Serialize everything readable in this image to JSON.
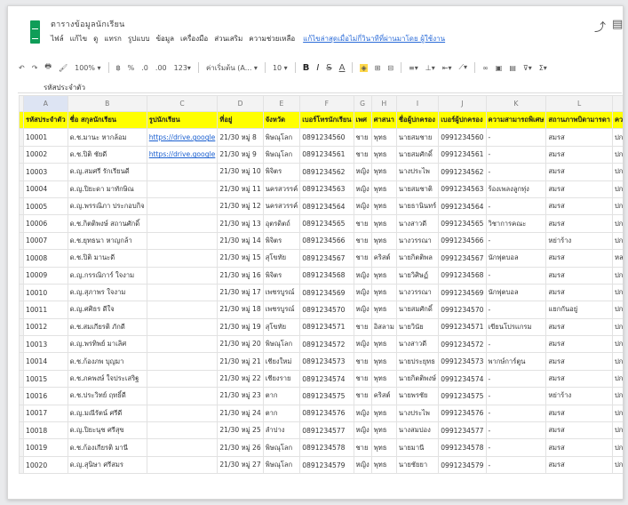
{
  "window": {
    "doc_title": "ตารางข้อมูลนักเรียน",
    "menu": [
      "ไฟล์",
      "แก้ไข",
      "ดู",
      "แทรก",
      "รูปแบบ",
      "ข้อมูล",
      "เครื่องมือ",
      "ส่วนเสริม",
      "ความช่วยเหลือ"
    ],
    "last_edit": "แก้ไขล่าสุดเมื่อไม่กี่วินาทีที่ผ่านมาโดย ผู้ใช้งาน"
  },
  "toolbar": {
    "undo": "↶",
    "redo": "↷",
    "print": "🖶",
    "paint": "🖌",
    "zoom": "100% ▾",
    "currency": "฿",
    "percent": "%",
    "dec_less": ".0",
    "dec_more": ".00",
    "format": "123▾",
    "font": "ค่าเริ่มต้น (A... ▾",
    "font_size": "10 ▾",
    "bold": "B",
    "italic": "I",
    "strike": "S",
    "text_color": "A",
    "fill": "◈",
    "borders": "⊞",
    "merge": "⊟",
    "align": "≡▾",
    "valign": "⊥▾",
    "wrap": "⇤▾",
    "rotate": "⟋▾",
    "link": "∞",
    "comment": "▣",
    "chart": "▤",
    "filter": "⊽▾",
    "functions": "Σ▾"
  },
  "formula_bar": "รหัสประจำตัว",
  "columns": [
    "A",
    "B",
    "C",
    "D",
    "E",
    "F",
    "G",
    "H",
    "I",
    "J",
    "K",
    "L",
    "M"
  ],
  "header_row": [
    "รหัสประจำตัว",
    "ชื่อ สกุลนักเรียน",
    "รูปนักเรียน",
    "ที่อยู่",
    "จังหวัด",
    "เบอร์โทรนักเรียน",
    "เพศ",
    "ศาสนา",
    "ชื่อผู้ปกครอง",
    "เบอร์ผู้ปกครอง",
    "ความสามารถพิเศษ",
    "สถานภาพบิดามารดา",
    "ความประพฤติ"
  ],
  "rows": [
    [
      "10001",
      "ด.ช.มานะ หากล้อม",
      "https://drive.google",
      "21/30 หมู่ 8",
      "พิษณุโลก",
      "0891234560",
      "ชาย",
      "พุทธ",
      "นายสมชาย",
      "0991234560",
      "-",
      "สมรส",
      "ปกติ"
    ],
    [
      "10002",
      "ด.ช.ปิติ ชัยดี",
      "https://drive.google",
      "21/30 หมู่ 9",
      "พิษณุโลก",
      "0891234561",
      "ชาย",
      "พุทธ",
      "นายสมศักดิ์",
      "0991234561",
      "-",
      "สมรส",
      "ปกติ"
    ],
    [
      "10003",
      "ด.ญ.สมศรี รักเรียนดี",
      "",
      "21/30 หมู่ 10",
      "พิจิตร",
      "0891234562",
      "หญิง",
      "พุทธ",
      "นางประไพ",
      "0991234562",
      "-",
      "สมรส",
      "ปกติ"
    ],
    [
      "10004",
      "ด.ญ.ปิยะดา มาทักษิณ",
      "",
      "21/30 หมู่ 11",
      "นครสวรรค์",
      "0891234563",
      "หญิง",
      "พุทธ",
      "นายสมชาติ",
      "0991234563",
      "ร้องเพลงลูกทุ่ง",
      "สมรส",
      "ปกติ"
    ],
    [
      "10005",
      "ด.ญ.พรรณิภา ประกอบกิจ",
      "",
      "21/30 หมู่ 12",
      "นครสวรรค์",
      "0891234564",
      "หญิง",
      "พุทธ",
      "นายธานินทร์",
      "0991234564",
      "-",
      "สมรส",
      "ปกติ"
    ],
    [
      "10006",
      "ด.ช.กิตติพงษ์ สถานศักดิ์",
      "",
      "21/30 หมู่ 13",
      "อุตรดิตถ์",
      "0891234565",
      "ชาย",
      "พุทธ",
      "นางสาวดี",
      "0991234565",
      "วิชาการคณะ",
      "สมรส",
      "ปกติ"
    ],
    [
      "10007",
      "ด.ช.ยุทธนา หาญกล้า",
      "",
      "21/30 หมู่ 14",
      "พิจิตร",
      "0891234566",
      "ชาย",
      "พุทธ",
      "นางวรรณา",
      "0991234566",
      "-",
      "หย่าร้าง",
      "ปกติ"
    ],
    [
      "10008",
      "ด.ช.ปิติ มานะดี",
      "",
      "21/30 หมู่ 15",
      "สุโขทัย",
      "0891234567",
      "ชาย",
      "คริสต์",
      "นายกิตติพล",
      "0991234567",
      "นักฟุตบอล",
      "สมรส",
      "หลงผิดทาง"
    ],
    [
      "10009",
      "ด.ญ.กรรณิการ์ ใจงาม",
      "",
      "21/30 หมู่ 16",
      "พิจิตร",
      "0891234568",
      "หญิง",
      "พุทธ",
      "นายวิศิษฏ์",
      "0991234568",
      "-",
      "สมรส",
      "ปกติ"
    ],
    [
      "10010",
      "ด.ญ.สุภาพร ใจงาม",
      "",
      "21/30 หมู่ 17",
      "เพชรบูรณ์",
      "0891234569",
      "หญิง",
      "พุทธ",
      "นางวรรณา",
      "0991234569",
      "นักฟุตบอล",
      "สมรส",
      "ปกติ"
    ],
    [
      "10011",
      "ด.ญ.ศศิธร ดีใจ",
      "",
      "21/30 หมู่ 18",
      "เพชรบูรณ์",
      "0891234570",
      "หญิง",
      "พุทธ",
      "นายสมศักดิ์",
      "0991234570",
      "-",
      "แยกกันอยู่",
      "ปกติ"
    ],
    [
      "10012",
      "ด.ช.สมเกียรติ ภักดี",
      "",
      "21/30 หมู่ 19",
      "สุโขทัย",
      "0891234571",
      "ชาย",
      "อิสลาม",
      "นายวินัย",
      "0991234571",
      "เขียนโปรแกรม",
      "สมรส",
      "ปกติ"
    ],
    [
      "10013",
      "ด.ญ.พรทิพย์ มาเลิศ",
      "",
      "21/30 หมู่ 20",
      "พิษณุโลก",
      "0891234572",
      "หญิง",
      "พุทธ",
      "นางสาวดี",
      "0991234572",
      "-",
      "สมรส",
      "ปกติ"
    ],
    [
      "10014",
      "ด.ช.ก้องภพ บุญมา",
      "",
      "21/30 หมู่ 21",
      "เชียงใหม่",
      "0891234573",
      "ชาย",
      "พุทธ",
      "นายประยุทธ",
      "0991234573",
      "พากษ์การ์ตูน",
      "สมรส",
      "ปกติ"
    ],
    [
      "10015",
      "ด.ช.ภคพงษ์ ใจประเสริฐ",
      "",
      "21/30 หมู่ 22",
      "เชียงราย",
      "0891234574",
      "ชาย",
      "พุทธ",
      "นายกิตติพงษ์",
      "0991234574",
      "-",
      "สมรส",
      "ปกติ"
    ],
    [
      "10016",
      "ด.ช.ประวิทย์ ฤทธิ์ดี",
      "",
      "21/30 หมู่ 23",
      "ตาก",
      "0891234575",
      "ชาย",
      "คริสต์",
      "นายพรชัย",
      "0991234575",
      "-",
      "หย่าร้าง",
      "ปกติ"
    ],
    [
      "10017",
      "ด.ญ.มณีรัตน์ ศรีดี",
      "",
      "21/30 หมู่ 24",
      "ตาก",
      "0891234576",
      "หญิง",
      "พุทธ",
      "นางประไพ",
      "0991234576",
      "-",
      "สมรส",
      "ปกติ"
    ],
    [
      "10018",
      "ด.ญ.ปิยะนุช ศรีสุข",
      "",
      "21/30 หมู่ 25",
      "ลำปาง",
      "0891234577",
      "หญิง",
      "พุทธ",
      "นางสมปอง",
      "0991234577",
      "-",
      "สมรส",
      "ปกติ"
    ],
    [
      "10019",
      "ด.ช.ก้องเกียรติ มานี",
      "",
      "21/30 หมู่ 26",
      "พิษณุโลก",
      "0891234578",
      "ชาย",
      "พุทธ",
      "นายมานี",
      "0991234578",
      "-",
      "สมรส",
      "ปกติ"
    ],
    [
      "10020",
      "ด.ญ.สุนิษา ศรีสมร",
      "",
      "21/30 หมู่ 27",
      "พิษณุโลก",
      "0891234579",
      "หญิง",
      "พุทธ",
      "นายชัยยา",
      "0991234579",
      "-",
      "สมรส",
      "ปกติ"
    ]
  ],
  "icons": {
    "trend": "trend-icon",
    "sheets": "sheets-logo-icon"
  }
}
